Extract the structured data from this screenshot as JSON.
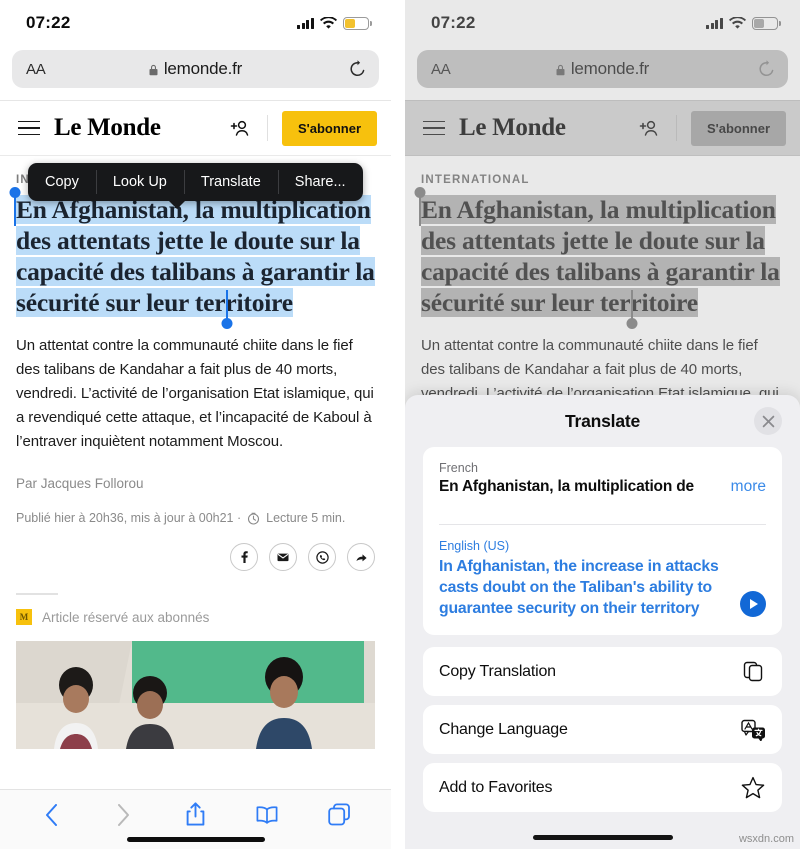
{
  "status_bar": {
    "time": "07:22",
    "signal_icon": "cellular-bars-icon",
    "wifi_icon": "wifi-icon",
    "battery_icon": "battery-icon"
  },
  "browser": {
    "aa_label": "AA",
    "lock_icon": "lock-icon",
    "url": "lemonde.fr",
    "reload_icon": "reload-icon",
    "toolbar": {
      "back_icon": "chevron-left-icon",
      "forward_icon": "chevron-right-icon",
      "share_icon": "share-up-icon",
      "bookmarks_icon": "book-icon",
      "tabs_icon": "tabs-icon"
    }
  },
  "site_header": {
    "menu_icon": "hamburger-menu-icon",
    "logo": "Le Monde",
    "account_icon": "add-account-icon",
    "subscribe_label": "S'abonner"
  },
  "article": {
    "kicker": "INTERNATIONAL",
    "headline": "En Afghanistan, la multiplication des attentats jette le doute sur la capacité des talibans à garantir la sécurité sur leur territoire",
    "body": "Un attentat contre la communauté chiite dans le fief des talibans de Kandahar a fait plus de 40 morts, vendredi. L’activité de l’organisation Etat islamique, qui a revendiqué cette attaque, et l’incapacité de Kaboul à l’entraver inquiètent notamment Moscou.",
    "byline": "Par Jacques Follorou",
    "pubinfo": "Publié hier à 20h36, mis à jour à 00h21 ·",
    "clock_icon": "clock-icon",
    "reading_time": "Lecture 5 min.",
    "share": [
      {
        "name": "facebook-share-icon",
        "glyph": "f"
      },
      {
        "name": "email-share-icon",
        "glyph": "✉"
      },
      {
        "name": "whatsapp-share-icon",
        "glyph": "✆"
      },
      {
        "name": "more-share-icon",
        "glyph": "➤"
      }
    ],
    "reserved_badge": "M",
    "reserved_label": "Article réservé aux abonnés",
    "photo_alt": "photo-men-seated"
  },
  "context_menu": {
    "items": [
      {
        "label": "Copy",
        "name": "menu-item-copy"
      },
      {
        "label": "Look Up",
        "name": "menu-item-look-up"
      },
      {
        "label": "Translate",
        "name": "menu-item-translate"
      },
      {
        "label": "Share...",
        "name": "menu-item-share"
      }
    ]
  },
  "translate_sheet": {
    "title": "Translate",
    "close_icon": "close-icon",
    "source": {
      "language": "French",
      "text": "En Afghanistan, la multiplication de",
      "more_label": "more"
    },
    "target": {
      "language": "English (US)",
      "text": "In Afghanistan, the increase in attacks casts doubt on the Taliban's ability to guarantee security on their territory",
      "play_icon": "play-audio-icon"
    },
    "actions": [
      {
        "label": "Copy Translation",
        "icon": "copy-documents-icon",
        "name": "action-copy-translation"
      },
      {
        "label": "Change Language",
        "icon": "language-swap-icon",
        "name": "action-change-language"
      },
      {
        "label": "Add to Favorites",
        "icon": "star-icon",
        "name": "action-add-to-favorites"
      }
    ]
  },
  "watermark": "wsxdn.com",
  "colors": {
    "accent_yellow": "#F7C10D",
    "selection_blue": "#BBDCF8",
    "link_blue": "#2d7de0",
    "toolbar_blue": "#2f7cf6"
  }
}
